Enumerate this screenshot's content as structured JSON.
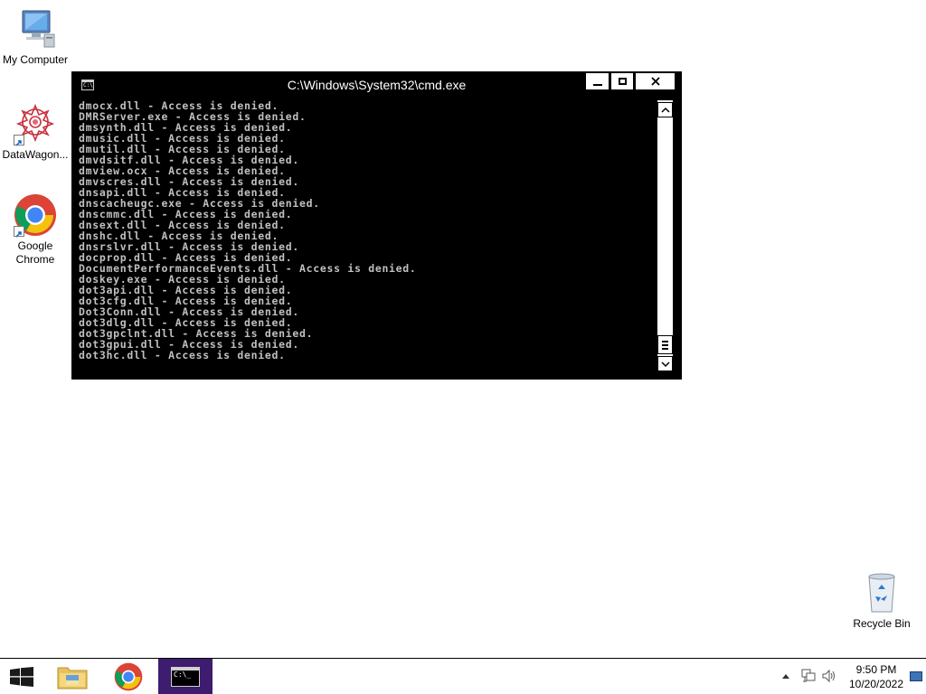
{
  "desktop": {
    "icons": [
      {
        "label": "My Computer",
        "icon": "computer-icon"
      },
      {
        "label": "DataWagon...",
        "icon": "datawagon-icon"
      },
      {
        "label": "Google Chrome",
        "icon": "chrome-icon"
      },
      {
        "label": "Recycle Bin",
        "icon": "recycle-bin-icon"
      }
    ]
  },
  "cmd_window": {
    "title": "C:\\Windows\\System32\\cmd.exe",
    "icon_text": "C:\\",
    "lines": [
      "dmocx.dll - Access is denied.",
      "DMRServer.exe - Access is denied.",
      "dmsynth.dll - Access is denied.",
      "dmusic.dll - Access is denied.",
      "dmutil.dll - Access is denied.",
      "dmvdsitf.dll - Access is denied.",
      "dmview.ocx - Access is denied.",
      "dmvscres.dll - Access is denied.",
      "dnsapi.dll - Access is denied.",
      "dnscacheugc.exe - Access is denied.",
      "dnscmmc.dll - Access is denied.",
      "dnsext.dll - Access is denied.",
      "dnshc.dll - Access is denied.",
      "dnsrslvr.dll - Access is denied.",
      "docprop.dll - Access is denied.",
      "DocumentPerformanceEvents.dll - Access is denied.",
      "doskey.exe - Access is denied.",
      "dot3api.dll - Access is denied.",
      "dot3cfg.dll - Access is denied.",
      "Dot3Conn.dll - Access is denied.",
      "dot3dlg.dll - Access is denied.",
      "dot3gpclnt.dll - Access is denied.",
      "dot3gpui.dll - Access is denied.",
      "dot3hc.dll - Access is denied."
    ],
    "scroll_position": 0.93,
    "colors": {
      "background": "#000000",
      "text": "#c0c0c0"
    }
  },
  "taskbar": {
    "items": [
      {
        "name": "start",
        "icon": "windows-logo-icon"
      },
      {
        "name": "file-explorer",
        "icon": "folder-icon"
      },
      {
        "name": "google-chrome",
        "icon": "chrome-icon"
      },
      {
        "name": "command-prompt",
        "icon": "cmd-icon",
        "active": true
      }
    ],
    "cmd_icon_text": "C:\\_",
    "active_color": "#3e1c6f",
    "clock": {
      "time": "9:50 PM",
      "date": "10/20/2022"
    }
  }
}
